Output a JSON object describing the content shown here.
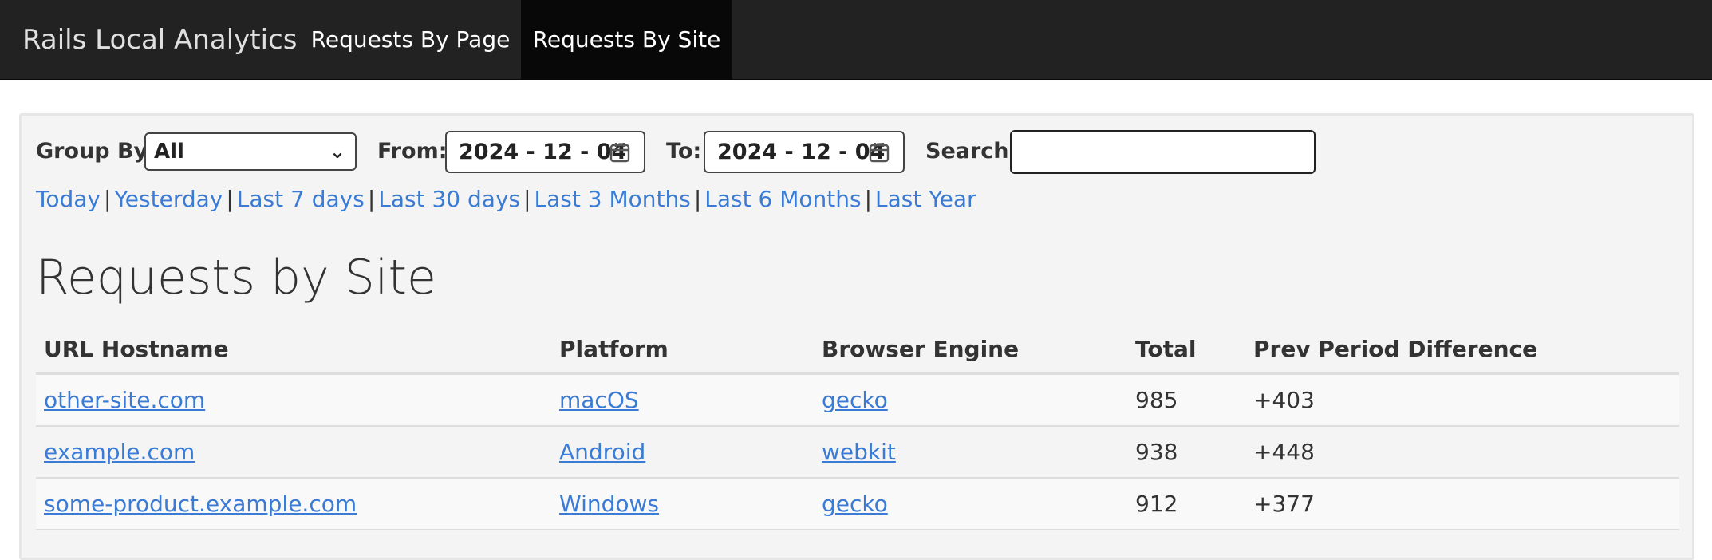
{
  "navbar": {
    "brand": "Rails Local Analytics",
    "links": [
      {
        "label": "Requests By Page"
      },
      {
        "label": "Requests By Site",
        "active": true
      }
    ]
  },
  "filters": {
    "group_by_label": "Group By:",
    "group_by_value": "All",
    "from_label": "From:",
    "from_value": "2024 - 12 - 04",
    "to_label": "To:",
    "to_value": "2024 - 12 - 04",
    "search_label": "Search:",
    "search_value": ""
  },
  "quick_ranges": [
    "Today",
    "Yesterday",
    "Last 7 days",
    "Last 30 days",
    "Last 3 Months",
    "Last 6 Months",
    "Last Year"
  ],
  "quick_range_separator": "|",
  "page_title": "Requests by Site",
  "table": {
    "headers": [
      "URL Hostname",
      "Platform",
      "Browser Engine",
      "Total",
      "Prev Period Difference"
    ],
    "rows": [
      {
        "hostname": "other-site.com",
        "platform": "macOS",
        "engine": "gecko",
        "total": "985",
        "diff": "+403"
      },
      {
        "hostname": "example.com",
        "platform": "Android",
        "engine": "webkit",
        "total": "938",
        "diff": "+448"
      },
      {
        "hostname": "some-product.example.com",
        "platform": "Windows",
        "engine": "gecko",
        "total": "912",
        "diff": "+377"
      }
    ]
  },
  "colors": {
    "navbar_bg": "#222222",
    "nav_active_bg": "#080808",
    "link": "#3a7bd5",
    "well_bg": "#f4f4f4"
  }
}
